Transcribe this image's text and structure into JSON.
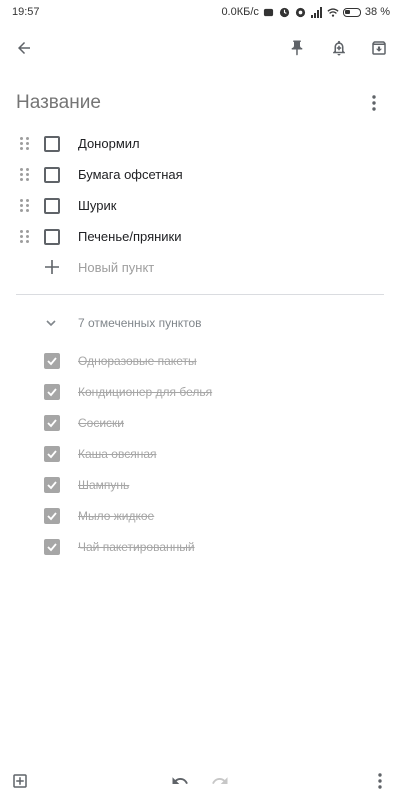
{
  "status_bar": {
    "time": "19:57",
    "network_speed": "0.0КБ/с",
    "battery": "38 %"
  },
  "toolbar": {
    "back_icon": "arrow-back-icon",
    "pin_icon": "pin-icon",
    "reminder_icon": "reminder-bell-icon",
    "archive_icon": "archive-icon"
  },
  "note": {
    "title_placeholder": "Название",
    "title_value": ""
  },
  "unchecked_items": [
    {
      "label": "Донормил"
    },
    {
      "label": "Бумага офсетная"
    },
    {
      "label": "Шурик"
    },
    {
      "label": "Печенье/пряники"
    }
  ],
  "new_item_placeholder": "Новый пункт",
  "checked_section": {
    "header": "7 отмеченных пунктов",
    "items": [
      {
        "label": "Одноразовые пакеты"
      },
      {
        "label": "Кондиционер для белья"
      },
      {
        "label": "Сосиски"
      },
      {
        "label": "Каша овсяная"
      },
      {
        "label": "Шампунь"
      },
      {
        "label": "Мыло жидкое"
      },
      {
        "label": "Чай пакетированный"
      }
    ]
  },
  "colors": {
    "checked_box": "#a6a6a6",
    "text_primary": "#202124",
    "text_muted": "#9e9e9e"
  }
}
